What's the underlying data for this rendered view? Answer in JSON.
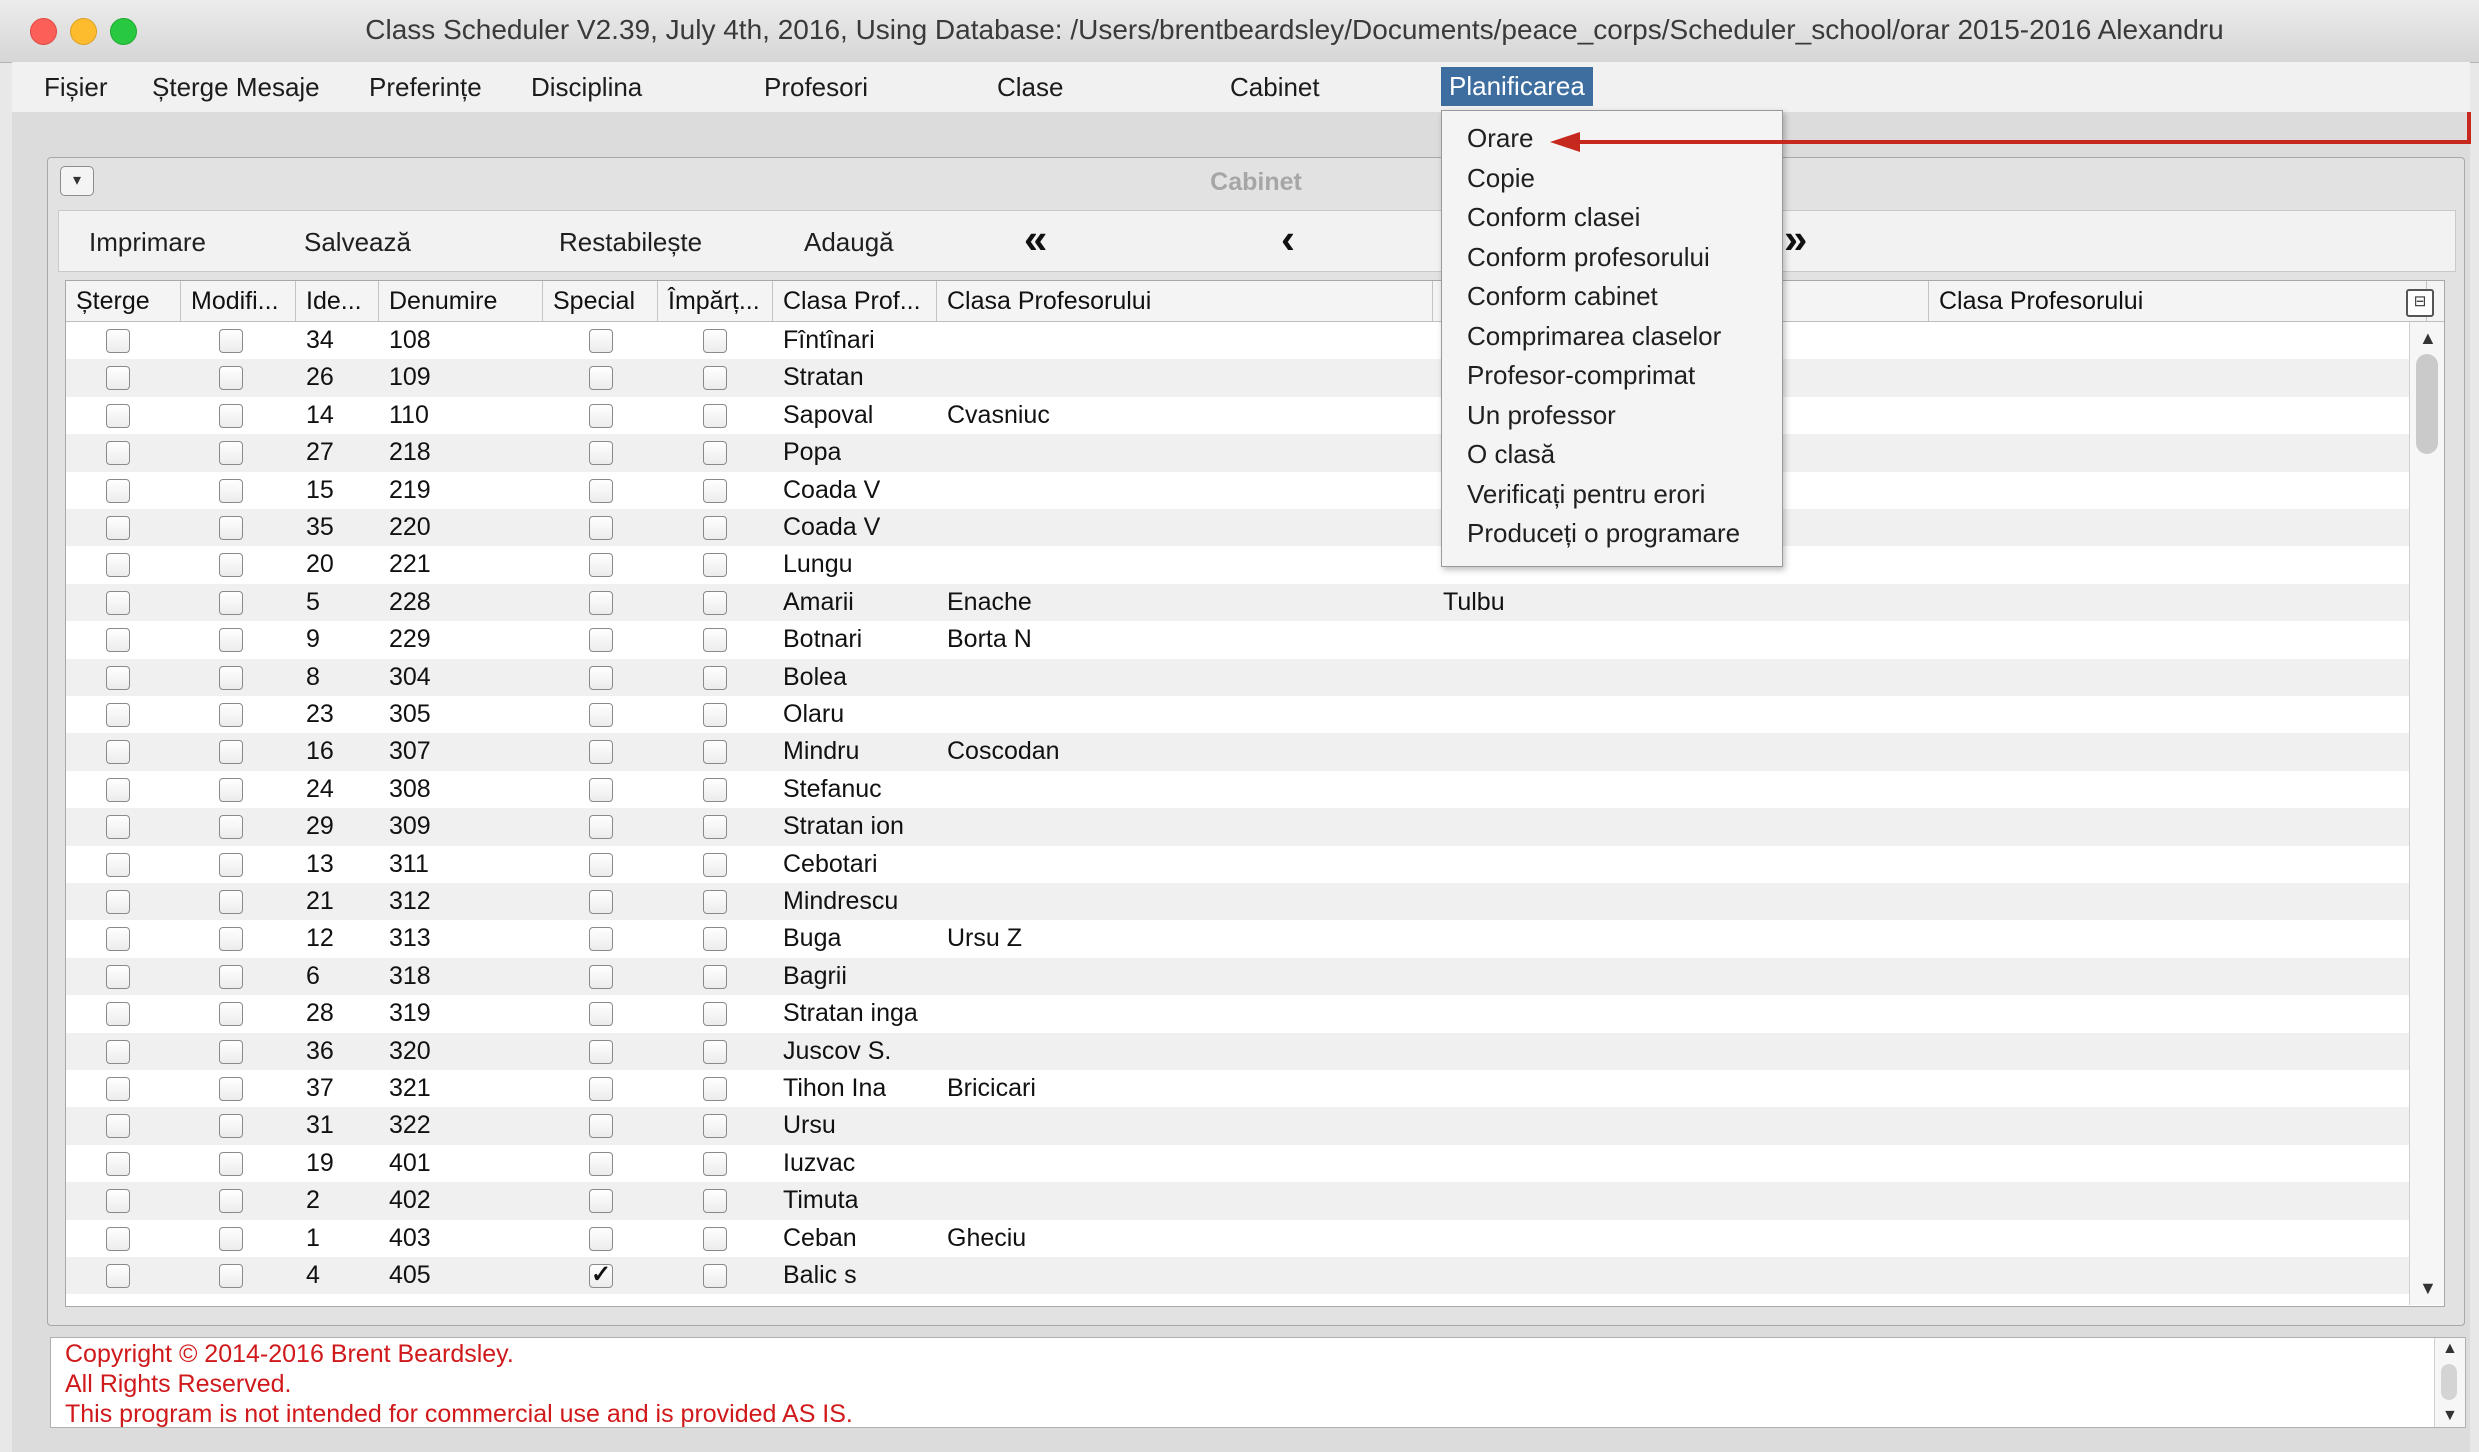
{
  "window": {
    "title": "Class Scheduler V2.39, July 4th, 2016, Using Database: /Users/brentbeardsley/Documents/peace_corps/Scheduler_school/orar 2015-2016 Alexandru"
  },
  "menubar": {
    "items": [
      "Fișier",
      "Șterge Mesaje",
      "Preferințe",
      "Disciplina",
      "Profesori",
      "Clase",
      "Cabinet",
      "Planificarea"
    ],
    "active": "Planificarea"
  },
  "dropdown": {
    "items": [
      "Orare",
      "Copie",
      "Conform clasei",
      "Conform profesorului",
      "Conform cabinet",
      "Comprimarea claselor",
      "Profesor-comprimat",
      "Un professor",
      "O clasă",
      "Verificați pentru erori",
      "Produceți o programare"
    ]
  },
  "panel": {
    "title": "Cabinet",
    "collapse_icon": "▾",
    "toolbar": {
      "print": "Imprimare",
      "save": "Salvează",
      "reset": "Restabilește",
      "add": "Adaugă",
      "first": "«",
      "prev": "‹",
      "next": "›",
      "last": "»"
    }
  },
  "table": {
    "columns": [
      "Șterge",
      "Modifi...",
      "Ide...",
      "Denumire",
      "Special",
      "Împărț...",
      "Clasa Prof...",
      "Clasa Profesorului",
      "",
      "Clasa Profesorului"
    ],
    "rows": [
      {
        "id": "34",
        "name": "108",
        "special": false,
        "cp1": "Fîntînari",
        "cp2": "",
        "cp3": ""
      },
      {
        "id": "26",
        "name": "109",
        "special": false,
        "cp1": "Stratan",
        "cp2": "",
        "cp3": ""
      },
      {
        "id": "14",
        "name": "110",
        "special": false,
        "cp1": "Sapoval",
        "cp2": "Cvasniuc",
        "cp3": ""
      },
      {
        "id": "27",
        "name": "218",
        "special": false,
        "cp1": "Popa",
        "cp2": "",
        "cp3": ""
      },
      {
        "id": "15",
        "name": "219",
        "special": false,
        "cp1": "Coada V",
        "cp2": "",
        "cp3": ""
      },
      {
        "id": "35",
        "name": "220",
        "special": false,
        "cp1": "Coada V",
        "cp2": "",
        "cp3": ""
      },
      {
        "id": "20",
        "name": "221",
        "special": false,
        "cp1": "Lungu",
        "cp2": "",
        "cp3": ""
      },
      {
        "id": "5",
        "name": "228",
        "special": false,
        "cp1": "Amarii",
        "cp2": "Enache",
        "cp3": "Tulbu"
      },
      {
        "id": "9",
        "name": "229",
        "special": false,
        "cp1": "Botnari",
        "cp2": "Borta N",
        "cp3": ""
      },
      {
        "id": "8",
        "name": "304",
        "special": false,
        "cp1": "Bolea",
        "cp2": "",
        "cp3": ""
      },
      {
        "id": "23",
        "name": "305",
        "special": false,
        "cp1": "Olaru",
        "cp2": "",
        "cp3": ""
      },
      {
        "id": "16",
        "name": "307",
        "special": false,
        "cp1": "Mindru",
        "cp2": "Coscodan",
        "cp3": ""
      },
      {
        "id": "24",
        "name": "308",
        "special": false,
        "cp1": "Stefanuc",
        "cp2": "",
        "cp3": ""
      },
      {
        "id": "29",
        "name": "309",
        "special": false,
        "cp1": "Stratan ion",
        "cp2": "",
        "cp3": ""
      },
      {
        "id": "13",
        "name": "311",
        "special": false,
        "cp1": "Cebotari",
        "cp2": "",
        "cp3": ""
      },
      {
        "id": "21",
        "name": "312",
        "special": false,
        "cp1": "Mindrescu",
        "cp2": "",
        "cp3": ""
      },
      {
        "id": "12",
        "name": "313",
        "special": false,
        "cp1": "Buga",
        "cp2": "Ursu Z",
        "cp3": ""
      },
      {
        "id": "6",
        "name": "318",
        "special": false,
        "cp1": "Bagrii",
        "cp2": "",
        "cp3": ""
      },
      {
        "id": "28",
        "name": "319",
        "special": false,
        "cp1": "Stratan inga",
        "cp2": "",
        "cp3": ""
      },
      {
        "id": "36",
        "name": "320",
        "special": false,
        "cp1": "Juscov S.",
        "cp2": "",
        "cp3": ""
      },
      {
        "id": "37",
        "name": "321",
        "special": false,
        "cp1": "Tihon Ina",
        "cp2": "Bricicari",
        "cp3": ""
      },
      {
        "id": "31",
        "name": "322",
        "special": false,
        "cp1": "Ursu",
        "cp2": "",
        "cp3": ""
      },
      {
        "id": "19",
        "name": "401",
        "special": false,
        "cp1": "Iuzvac",
        "cp2": "",
        "cp3": ""
      },
      {
        "id": "2",
        "name": "402",
        "special": false,
        "cp1": "Timuta",
        "cp2": "",
        "cp3": ""
      },
      {
        "id": "1",
        "name": "403",
        "special": false,
        "cp1": "Ceban",
        "cp2": "Gheciu",
        "cp3": ""
      },
      {
        "id": "4",
        "name": "405",
        "special": true,
        "cp1": "Balic s",
        "cp2": "",
        "cp3": ""
      }
    ]
  },
  "messages": {
    "lines": [
      "Copyright © 2014-2016 Brent Beardsley.",
      "All Rights Reserved.",
      "This program is not intended for commercial use and is provided AS IS."
    ]
  },
  "icons": {
    "scroll_up": "▲",
    "scroll_down": "▼",
    "check": "✓",
    "column_chooser": "⊟"
  },
  "colors": {
    "accent": "#3e6da0",
    "message_text": "#d0191b",
    "annotation": "#c6281e"
  }
}
